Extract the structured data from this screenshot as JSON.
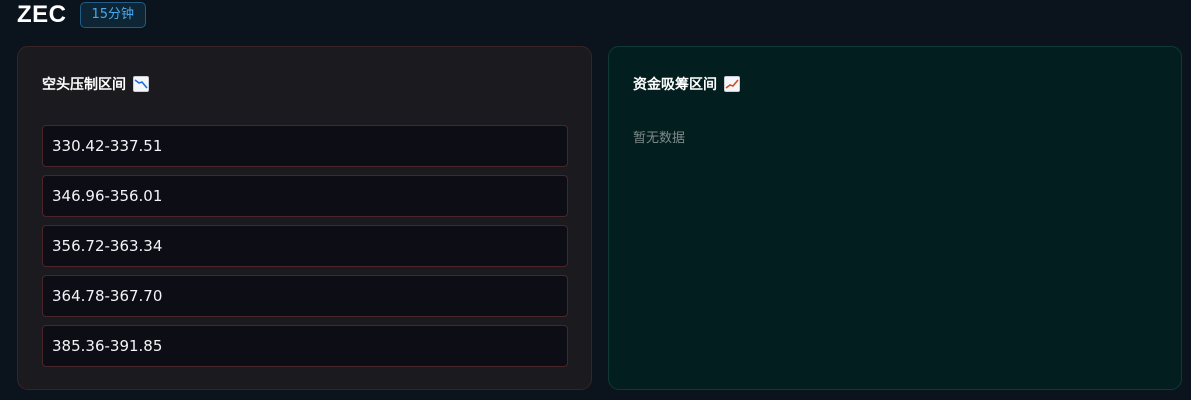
{
  "header": {
    "symbol": "ZEC",
    "timeframe": "15分钟"
  },
  "bear_panel": {
    "title": "空头压制区间",
    "icon": "chart-decreasing-icon",
    "ranges": [
      "330.42-337.51",
      "346.96-356.01",
      "356.72-363.34",
      "364.78-367.70",
      "385.36-391.85"
    ]
  },
  "bull_panel": {
    "title": "资金吸筹区间",
    "icon": "chart-increasing-icon",
    "empty_text": "暂无数据"
  },
  "colors": {
    "background": "#0b141d",
    "bear_panel_bg": "#1a1a1f",
    "bear_border": "#4a262b",
    "bull_panel_bg": "#031e1f",
    "badge_text": "#49a9ec"
  }
}
